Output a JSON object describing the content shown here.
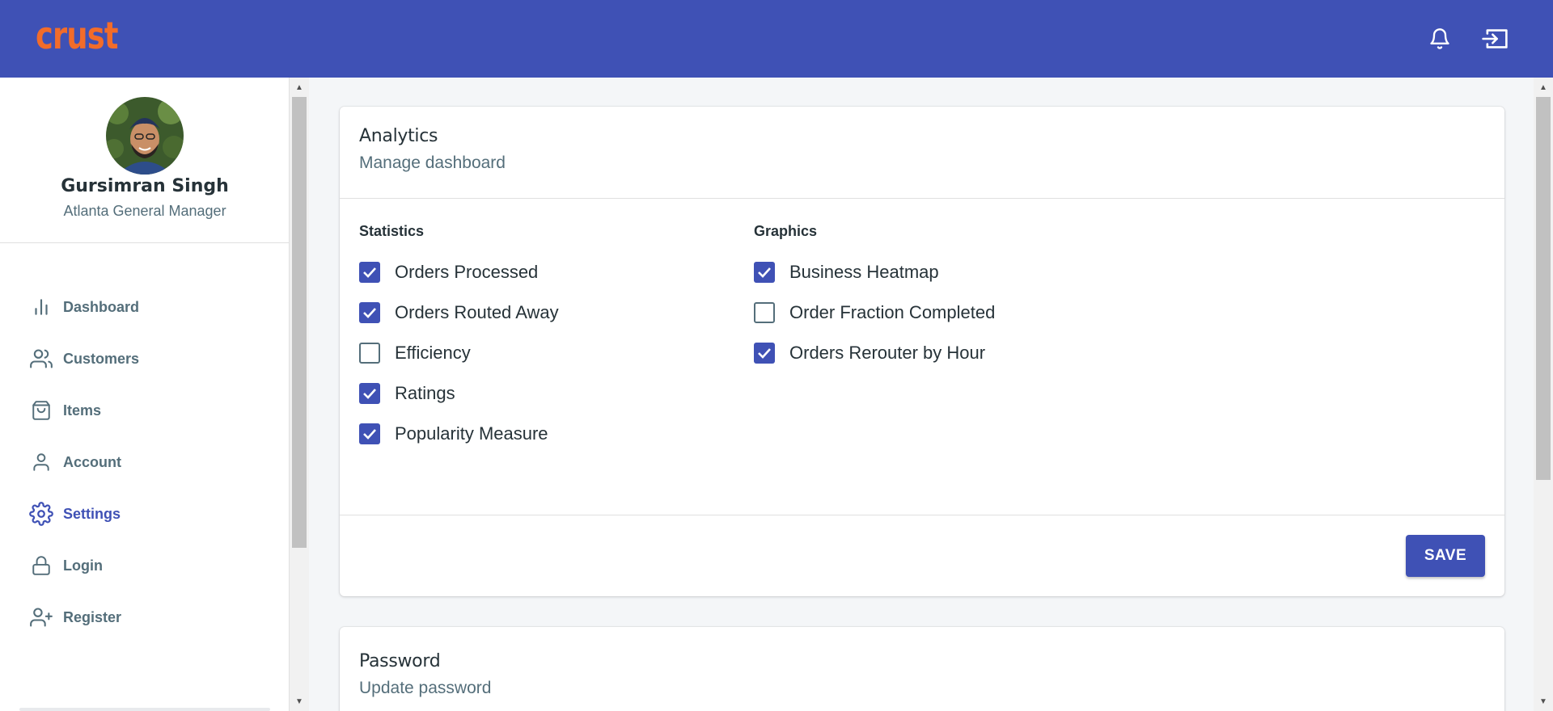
{
  "brand": {
    "logo_text": "crust",
    "logo_color": "#f26c2a",
    "topbar_color": "#3f51b5"
  },
  "topbar": {
    "icons": [
      "bell-icon",
      "logout-icon"
    ]
  },
  "profile": {
    "name": "Gursimran Singh",
    "role": "Atlanta General Manager"
  },
  "nav": {
    "items": [
      {
        "label": "Dashboard",
        "icon": "bar-chart-icon",
        "active": false
      },
      {
        "label": "Customers",
        "icon": "users-icon",
        "active": false
      },
      {
        "label": "Items",
        "icon": "shopping-bag-icon",
        "active": false
      },
      {
        "label": "Account",
        "icon": "user-icon",
        "active": false
      },
      {
        "label": "Settings",
        "icon": "gear-icon",
        "active": true
      },
      {
        "label": "Login",
        "icon": "lock-icon",
        "active": false
      },
      {
        "label": "Register",
        "icon": "user-plus-icon",
        "active": false
      }
    ]
  },
  "analytics": {
    "title": "Analytics",
    "subtitle": "Manage dashboard",
    "statistics": {
      "title": "Statistics",
      "options": [
        {
          "label": "Orders Processed",
          "checked": true
        },
        {
          "label": "Orders Routed Away",
          "checked": true
        },
        {
          "label": "Efficiency",
          "checked": false
        },
        {
          "label": "Ratings",
          "checked": true
        },
        {
          "label": "Popularity Measure",
          "checked": true
        }
      ]
    },
    "graphics": {
      "title": "Graphics",
      "options": [
        {
          "label": "Business Heatmap",
          "checked": true
        },
        {
          "label": "Order Fraction Completed",
          "checked": false
        },
        {
          "label": "Orders Rerouter by Hour",
          "checked": true
        }
      ]
    },
    "save_label": "SAVE"
  },
  "password": {
    "title": "Password",
    "subtitle": "Update password"
  }
}
